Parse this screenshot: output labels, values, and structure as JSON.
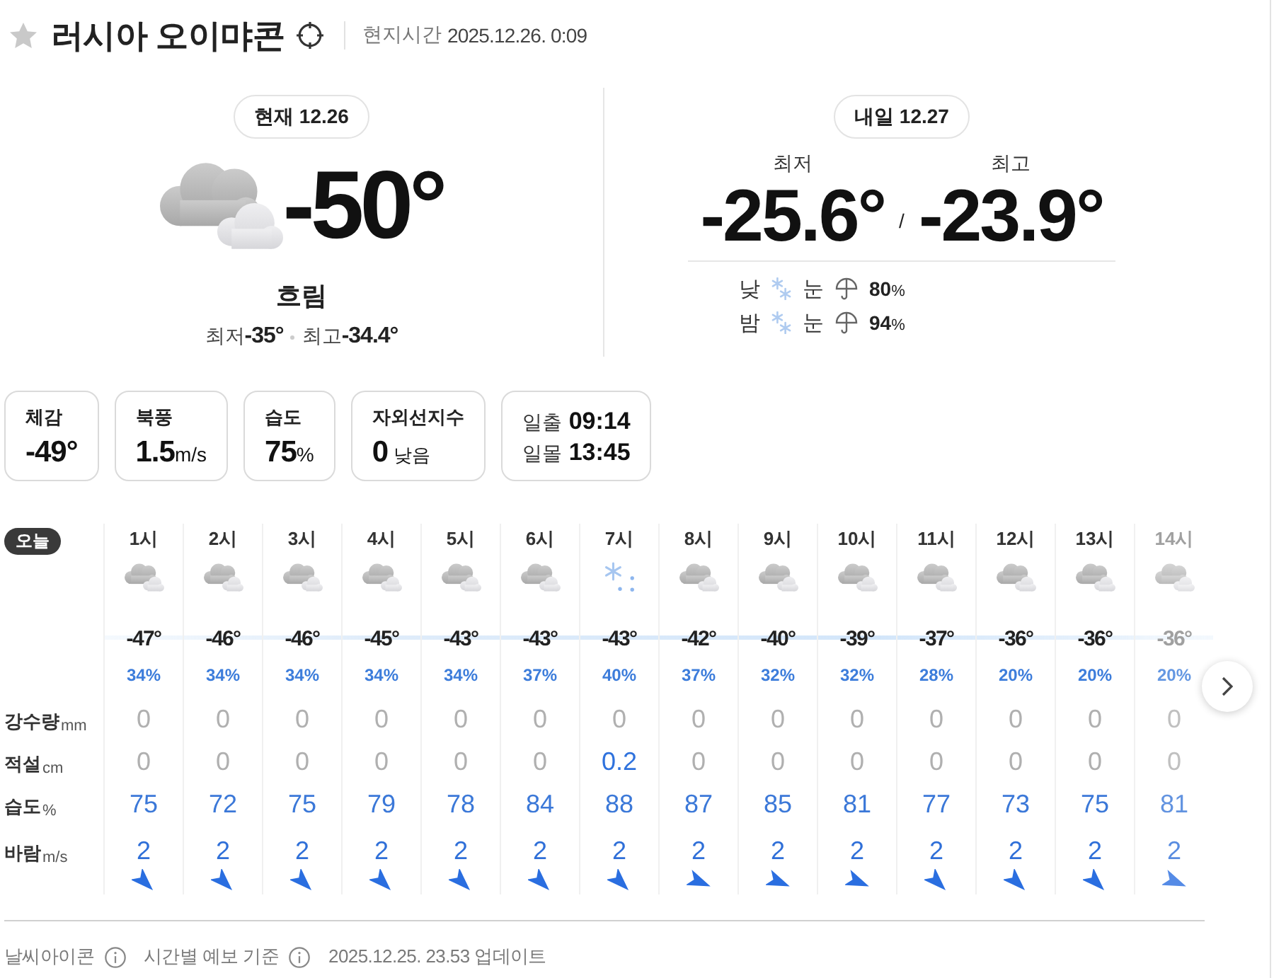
{
  "header": {
    "favorite": false,
    "title": "러시아 오이먀콘",
    "time_label": "현지시간",
    "time": "2025.12.26. 0:09"
  },
  "today": {
    "badge": "현재 12.26",
    "kind": "cloudy",
    "temperature": "-50°",
    "condition": "흐림",
    "low_label": "최저",
    "low": "-35°",
    "high_label": "최고",
    "high": "-34.4°"
  },
  "tomorrow": {
    "badge": "내일 12.27",
    "low_label": "최저",
    "low": "-25.6°",
    "separator": "/",
    "high_label": "최고",
    "high": "-23.9°",
    "periods": [
      {
        "label": "낮",
        "kind": "snow",
        "condition": "눈",
        "chance": "80",
        "unit": "%"
      },
      {
        "label": "밤",
        "kind": "snow",
        "condition": "눈",
        "chance": "94",
        "unit": "%"
      }
    ]
  },
  "details": [
    {
      "kind": "value",
      "label": "체감",
      "value": "-49°"
    },
    {
      "kind": "value",
      "label": "북풍",
      "value": "1.5",
      "unit": "m/s"
    },
    {
      "kind": "value",
      "label": "습도",
      "value": "75",
      "unit": "%"
    },
    {
      "kind": "value",
      "label": "자외선지수",
      "value": "0",
      "note": "낮음"
    },
    {
      "kind": "sun",
      "rows": [
        {
          "label": "일출",
          "time": "09:14"
        },
        {
          "label": "일몰",
          "time": "13:45"
        }
      ]
    }
  ],
  "hourly": {
    "day_badge": "오늘",
    "row_labels": [
      {
        "label": "강수량",
        "unit": "mm"
      },
      {
        "label": "적설",
        "unit": "cm"
      },
      {
        "label": "습도",
        "unit": "%"
      },
      {
        "label": "바람",
        "unit": "m/s"
      }
    ],
    "hours": [
      {
        "time": "1시",
        "kind": "cloudy",
        "temperature": "-47°",
        "chance": "34%",
        "precipitation": {
          "amount": "0",
          "measurable": false
        },
        "snowfall": {
          "amount": "0",
          "measurable": false
        },
        "humidity": "75",
        "wind": {
          "speed": "2",
          "kind": "NW"
        }
      },
      {
        "time": "2시",
        "kind": "cloudy",
        "temperature": "-46°",
        "chance": "34%",
        "precipitation": {
          "amount": "0",
          "measurable": false
        },
        "snowfall": {
          "amount": "0",
          "measurable": false
        },
        "humidity": "72",
        "wind": {
          "speed": "2",
          "kind": "NW"
        }
      },
      {
        "time": "3시",
        "kind": "cloudy",
        "temperature": "-46°",
        "chance": "34%",
        "precipitation": {
          "amount": "0",
          "measurable": false
        },
        "snowfall": {
          "amount": "0",
          "measurable": false
        },
        "humidity": "75",
        "wind": {
          "speed": "2",
          "kind": "NW"
        }
      },
      {
        "time": "4시",
        "kind": "cloudy",
        "temperature": "-45°",
        "chance": "34%",
        "precipitation": {
          "amount": "0",
          "measurable": false
        },
        "snowfall": {
          "amount": "0",
          "measurable": false
        },
        "humidity": "79",
        "wind": {
          "speed": "2",
          "kind": "NW"
        }
      },
      {
        "time": "5시",
        "kind": "cloudy",
        "temperature": "-43°",
        "chance": "34%",
        "precipitation": {
          "amount": "0",
          "measurable": false
        },
        "snowfall": {
          "amount": "0",
          "measurable": false
        },
        "humidity": "78",
        "wind": {
          "speed": "2",
          "kind": "NW"
        }
      },
      {
        "time": "6시",
        "kind": "cloudy",
        "temperature": "-43°",
        "chance": "37%",
        "precipitation": {
          "amount": "0",
          "measurable": false
        },
        "snowfall": {
          "amount": "0",
          "measurable": false
        },
        "humidity": "84",
        "wind": {
          "speed": "2",
          "kind": "NW"
        }
      },
      {
        "time": "7시",
        "kind": "snow",
        "temperature": "-43°",
        "chance": "40%",
        "precipitation": {
          "amount": "0",
          "measurable": false
        },
        "snowfall": {
          "amount": "0.2",
          "measurable": true
        },
        "humidity": "88",
        "wind": {
          "speed": "2",
          "kind": "NW"
        }
      },
      {
        "time": "8시",
        "kind": "cloudy",
        "temperature": "-42°",
        "chance": "37%",
        "precipitation": {
          "amount": "0",
          "measurable": false
        },
        "snowfall": {
          "amount": "0",
          "measurable": false
        },
        "humidity": "87",
        "wind": {
          "speed": "2",
          "kind": "WNW"
        }
      },
      {
        "time": "9시",
        "kind": "cloudy",
        "temperature": "-40°",
        "chance": "32%",
        "precipitation": {
          "amount": "0",
          "measurable": false
        },
        "snowfall": {
          "amount": "0",
          "measurable": false
        },
        "humidity": "85",
        "wind": {
          "speed": "2",
          "kind": "WNW"
        }
      },
      {
        "time": "10시",
        "kind": "cloudy",
        "temperature": "-39°",
        "chance": "32%",
        "precipitation": {
          "amount": "0",
          "measurable": false
        },
        "snowfall": {
          "amount": "0",
          "measurable": false
        },
        "humidity": "81",
        "wind": {
          "speed": "2",
          "kind": "WNW"
        }
      },
      {
        "time": "11시",
        "kind": "cloudy",
        "temperature": "-37°",
        "chance": "28%",
        "precipitation": {
          "amount": "0",
          "measurable": false
        },
        "snowfall": {
          "amount": "0",
          "measurable": false
        },
        "humidity": "77",
        "wind": {
          "speed": "2",
          "kind": "NW"
        }
      },
      {
        "time": "12시",
        "kind": "cloudy",
        "temperature": "-36°",
        "chance": "20%",
        "precipitation": {
          "amount": "0",
          "measurable": false
        },
        "snowfall": {
          "amount": "0",
          "measurable": false
        },
        "humidity": "73",
        "wind": {
          "speed": "2",
          "kind": "NW"
        }
      },
      {
        "time": "13시",
        "kind": "cloudy",
        "temperature": "-36°",
        "chance": "20%",
        "precipitation": {
          "amount": "0",
          "measurable": false
        },
        "snowfall": {
          "amount": "0",
          "measurable": false
        },
        "humidity": "75",
        "wind": {
          "speed": "2",
          "kind": "NW"
        }
      },
      {
        "time": "14시",
        "kind": "cloudy",
        "temperature": "-36°",
        "chance": "20%",
        "precipitation": {
          "amount": "0",
          "measurable": false
        },
        "snowfall": {
          "amount": "0",
          "measurable": false
        },
        "humidity": "81",
        "wind": {
          "speed": "2",
          "kind": "WNW"
        }
      }
    ]
  },
  "footer": [
    {
      "text": "날씨아이콘",
      "info": true
    },
    {
      "text": "시간별 예보 기준",
      "info": true
    },
    {
      "text": "2025.12.25. 23.53 업데이트",
      "info": false
    }
  ]
}
